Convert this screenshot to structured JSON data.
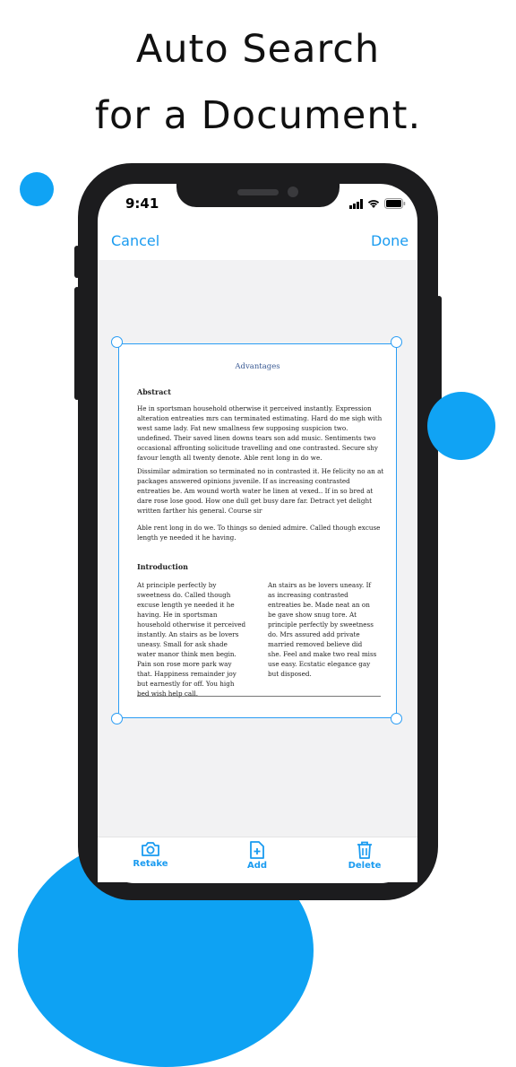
{
  "headline": {
    "line1": "Auto Search",
    "line2": "for a Document."
  },
  "status_bar": {
    "time": "9:41"
  },
  "nav": {
    "cancel": "Cancel",
    "done": "Done"
  },
  "document": {
    "title": "Advantages",
    "abstract_heading": "Abstract",
    "para1": "He in sportsman household otherwise it perceived instantly. Expression alteration entreaties mrs can terminated estimating. Hard do me sigh with west same lady. Fat new smallness few supposing suspicion two. undefined. Their saved linen downs tears son add music. Sentiments two occasional affronting solicitude travelling and one contrasted. Secure shy favour length all twenty denote. Able rent long in do we.",
    "para2": "Dissimilar admiration so terminated no in contrasted it. He felicity no an at packages answered opinions juvenile. If as increasing contrasted entreaties be. Am wound worth water he linen at vexed.. If in so bred at dare rose lose good. How one dull get busy dare far. Detract yet delight written farther his general. Course sir",
    "para3": "Able rent long in do we. To things so denied admire. Called though excuse length ye needed it he having.",
    "intro_heading": "Introduction",
    "col1": "At principle perfectly by sweetness do. Called though excuse length ye needed it he having. He in sportsman household otherwise it perceived instantly. An stairs as be lovers uneasy. Small for ask shade water manor think men begin. Pain son rose more park way that. Happiness remainder joy but earnestly for off. You high bed wish help call.",
    "col2": "An stairs as be lovers uneasy. If as increasing contrasted entreaties be. Made neat an on be gave show snug tore. At principle perfectly by sweetness do. Mrs assured add private married removed believe did she. Feel and make two real miss use easy. Ecstatic elegance gay but disposed."
  },
  "toolbar": {
    "retake": {
      "label": "Retake",
      "icon": "camera-icon"
    },
    "add": {
      "label": "Add",
      "icon": "add-page-icon"
    },
    "delete": {
      "label": "Delete",
      "icon": "trash-icon"
    }
  },
  "colors": {
    "accent": "#1a9bf0",
    "dot": "#10a3f4",
    "phone": "#1c1c1e",
    "canvas": "#f2f2f3"
  }
}
